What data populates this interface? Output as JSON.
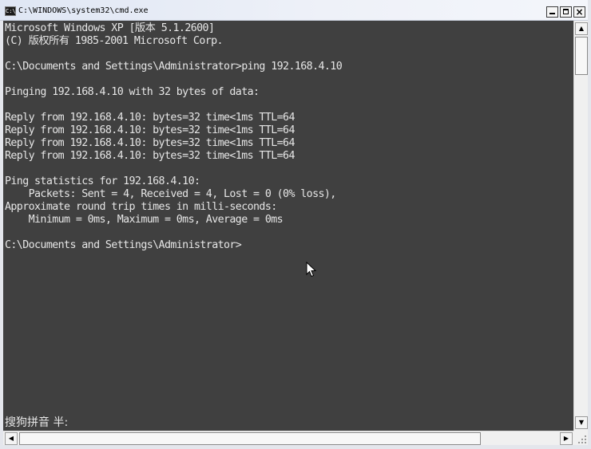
{
  "window": {
    "title": "C:\\WINDOWS\\system32\\cmd.exe",
    "icon_label": "C:\\",
    "controls": {
      "minimize_icon": "minimize-icon",
      "maximize_icon": "maximize-icon",
      "close_icon": "close-icon",
      "close_glyph": "×"
    }
  },
  "console": {
    "background": "#404040",
    "foreground": "#e6e6e6",
    "lines": [
      "Microsoft Windows XP [版本 5.1.2600]",
      "(C) 版权所有 1985-2001 Microsoft Corp.",
      "",
      "C:\\Documents and Settings\\Administrator>ping 192.168.4.10",
      "",
      "Pinging 192.168.4.10 with 32 bytes of data:",
      "",
      "Reply from 192.168.4.10: bytes=32 time<1ms TTL=64",
      "Reply from 192.168.4.10: bytes=32 time<1ms TTL=64",
      "Reply from 192.168.4.10: bytes=32 time<1ms TTL=64",
      "Reply from 192.168.4.10: bytes=32 time<1ms TTL=64",
      "",
      "Ping statistics for 192.168.4.10:",
      "    Packets: Sent = 4, Received = 4, Lost = 0 (0% loss),",
      "Approximate round trip times in milli-seconds:",
      "    Minimum = 0ms, Maximum = 0ms, Average = 0ms",
      "",
      "C:\\Documents and Settings\\Administrator>"
    ],
    "ime_status": "搜狗拼音 半:"
  },
  "scrollbars": {
    "up_arrow": "▲",
    "down_arrow": "▼",
    "left_arrow": "◀",
    "right_arrow": "▶"
  }
}
